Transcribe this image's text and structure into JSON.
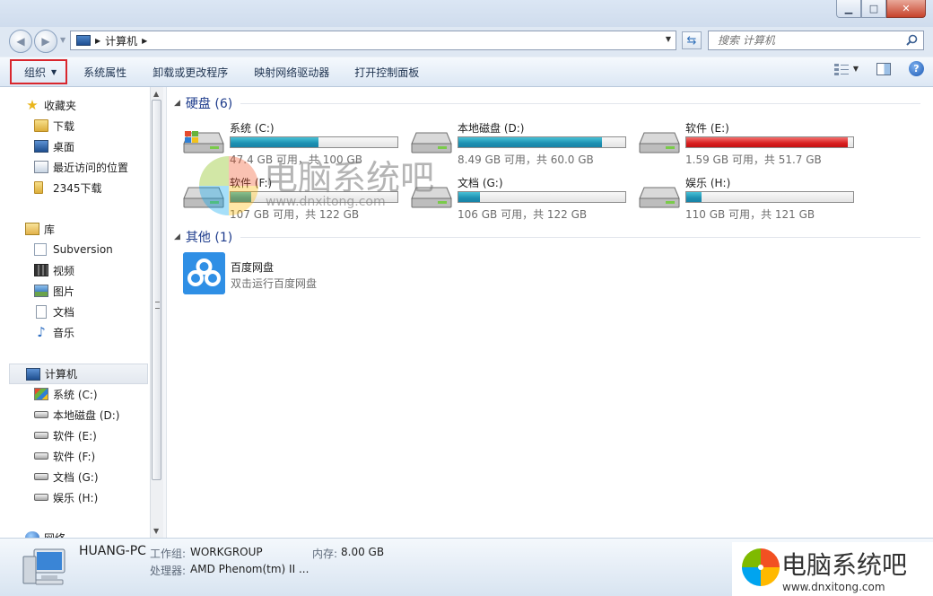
{
  "title_bar": {
    "minimize": "▁",
    "maximize": "□",
    "close": "✕"
  },
  "address": {
    "path": [
      "计算机"
    ],
    "search_placeholder": "搜索 计算机"
  },
  "toolbar": {
    "organize": "组织",
    "system_properties": "系统属性",
    "uninstall": "卸载或更改程序",
    "map_drive": "映射网络驱动器",
    "control_panel": "打开控制面板",
    "help": "?"
  },
  "nav": {
    "favorites": {
      "label": "收藏夹",
      "items": [
        "下载",
        "桌面",
        "最近访问的位置",
        "2345下载"
      ]
    },
    "libraries": {
      "label": "库",
      "items": [
        "Subversion",
        "视频",
        "图片",
        "文档",
        "音乐"
      ]
    },
    "computer": {
      "label": "计算机",
      "items": [
        "系统 (C:)",
        "本地磁盘 (D:)",
        "软件 (E:)",
        "软件 (F:)",
        "文档 (G:)",
        "娱乐 (H:)"
      ]
    },
    "network": {
      "label": "网络"
    }
  },
  "main": {
    "hard_disks_header": "硬盘 (6)",
    "other_header": "其他 (1)",
    "drives": [
      {
        "name": "系统 (C:)",
        "info": "47.4 GB 可用，共 100 GB",
        "used_fraction": 0.526,
        "warn": false,
        "system": true
      },
      {
        "name": "本地磁盘 (D:)",
        "info": "8.49 GB 可用，共 60.0 GB",
        "used_fraction": 0.858,
        "warn": false,
        "system": false
      },
      {
        "name": "软件 (E:)",
        "info": "1.59 GB 可用，共 51.7 GB",
        "used_fraction": 0.969,
        "warn": true,
        "system": false
      },
      {
        "name": "软件 (F:)",
        "info": "107 GB 可用，共 122 GB",
        "used_fraction": 0.123,
        "warn": false,
        "system": false
      },
      {
        "name": "文档 (G:)",
        "info": "106 GB 可用，共 122 GB",
        "used_fraction": 0.131,
        "warn": false,
        "system": false
      },
      {
        "name": "娱乐 (H:)",
        "info": "110 GB 可用，共 121 GB",
        "used_fraction": 0.091,
        "warn": false,
        "system": false
      }
    ],
    "other": {
      "name": "百度网盘",
      "desc": "双击运行百度网盘"
    }
  },
  "status": {
    "pc_name": "HUANG-PC",
    "workgroup_label": "工作组:",
    "workgroup": "WORKGROUP",
    "memory_label": "内存:",
    "memory": "8.00 GB",
    "processor_label": "处理器:",
    "processor": "AMD Phenom(tm) II ..."
  },
  "watermark": {
    "text": "电脑系统吧",
    "url": "www.dnxitong.com"
  },
  "colors": {
    "bar_fill": "#1d8fb1",
    "bar_warn": "#d81e1e",
    "organize_highlight": "#d9262d",
    "header_blue": "#1e3c8c"
  }
}
